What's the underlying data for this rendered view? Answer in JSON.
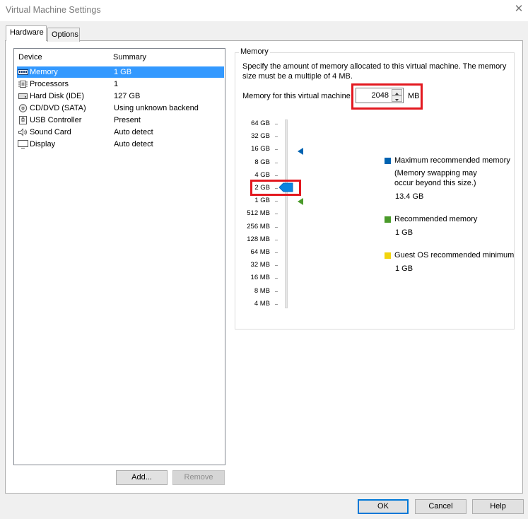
{
  "window": {
    "title": "Virtual Machine Settings"
  },
  "tabs": [
    {
      "label": "Hardware"
    },
    {
      "label": "Options"
    }
  ],
  "device_list": {
    "columns": {
      "device": "Device",
      "summary": "Summary"
    },
    "rows": [
      {
        "name": "Memory",
        "summary": "1 GB",
        "icon": "memory-icon"
      },
      {
        "name": "Processors",
        "summary": "1",
        "icon": "processor-icon"
      },
      {
        "name": "Hard Disk (IDE)",
        "summary": "127 GB",
        "icon": "hard-disk-icon"
      },
      {
        "name": "CD/DVD (SATA)",
        "summary": "Using unknown backend",
        "icon": "cd-dvd-icon"
      },
      {
        "name": "USB Controller",
        "summary": "Present",
        "icon": "usb-icon"
      },
      {
        "name": "Sound Card",
        "summary": "Auto detect",
        "icon": "speaker-icon"
      },
      {
        "name": "Display",
        "summary": "Auto detect",
        "icon": "monitor-icon"
      }
    ],
    "selected": "Memory"
  },
  "buttons": {
    "add": "Add...",
    "remove": "Remove",
    "ok": "OK",
    "cancel": "Cancel",
    "help": "Help"
  },
  "memory": {
    "group_title": "Memory",
    "description": "Specify the amount of memory allocated to this virtual machine. The memory size must be a multiple of 4 MB.",
    "field_label": "Memory for this virtual machine:",
    "value": "2048",
    "unit": "MB",
    "scale": [
      "64 GB",
      "32 GB",
      "16 GB",
      "8 GB",
      "4 GB",
      "2 GB",
      "1 GB",
      "512 MB",
      "256 MB",
      "128 MB",
      "64 MB",
      "32 MB",
      "16 MB",
      "8 MB",
      "4 MB"
    ],
    "slider_value": "2 GB",
    "max_recommended_marker": "16 GB",
    "recommended_marker": "1 GB",
    "legend": {
      "max_label": "Maximum recommended memory",
      "max_note": "(Memory swapping may occur beyond this size.)",
      "max_value": "13.4 GB",
      "rec_label": "Recommended memory",
      "rec_value": "1 GB",
      "guest_label": "Guest OS recommended minimum",
      "guest_value": "1 GB"
    }
  },
  "colors": {
    "selection": "#3399ff",
    "max_recommended": "#0063b1",
    "recommended": "#4a9a2a",
    "guest_min": "#f2d40c",
    "highlight": "#e3181f"
  }
}
